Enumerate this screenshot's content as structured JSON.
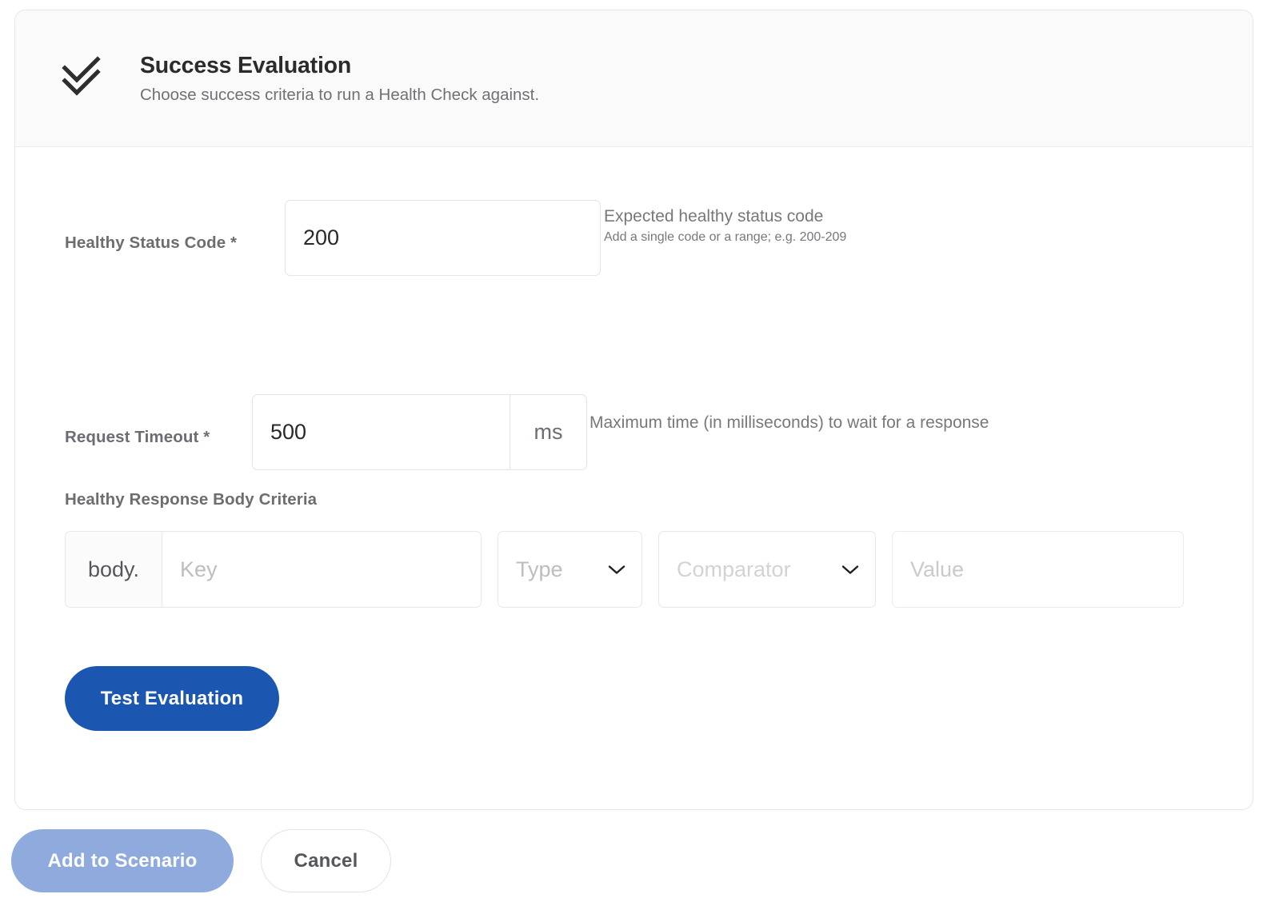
{
  "card": {
    "header": {
      "icon": "double-check-icon",
      "title": "Success Evaluation",
      "subtitle": "Choose success criteria to run a Health Check against."
    }
  },
  "fields": {
    "healthy_status_code": {
      "label": "Healthy Status Code *",
      "value": "200",
      "placeholder": "",
      "help_main": "Expected healthy status code",
      "help_sub": "Add a single code or a range; e.g. 200-209"
    },
    "request_timeout": {
      "label": "Request Timeout *",
      "value": "500",
      "placeholder": "",
      "unit": "ms",
      "help_main": "Maximum time (in milliseconds) to wait for a response"
    },
    "body_criteria": {
      "label": "Healthy Response Body Criteria",
      "prefix": "body.",
      "key_placeholder": "Key",
      "type_placeholder": "Type",
      "comparator_placeholder": "Comparator",
      "value_placeholder": "Value"
    }
  },
  "actions": {
    "test_evaluation": "Test Evaluation",
    "add_to_scenario": "Add to Scenario",
    "cancel": "Cancel"
  },
  "colors": {
    "primary": "#1b56b0",
    "primary_disabled": "#8fabdd",
    "label": "#6b6d72",
    "help": "#76787d",
    "border": "#e3e4e6",
    "header_bg": "#fafafa"
  }
}
